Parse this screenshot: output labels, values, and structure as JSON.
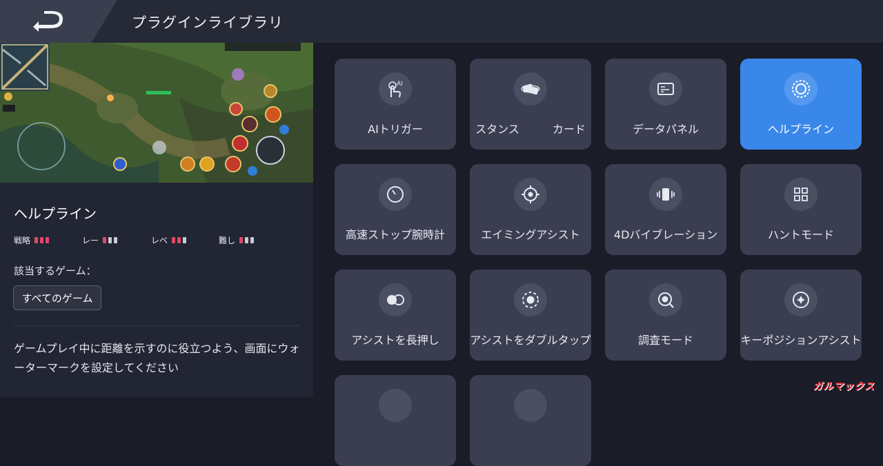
{
  "header": {
    "title": "プラグインライブラリ"
  },
  "detail": {
    "name": "ヘルプライン",
    "ratings": [
      {
        "label": "戦略",
        "level": 3,
        "max": 3
      },
      {
        "label": "レー",
        "level": 1,
        "max": 3
      },
      {
        "label": "レベ",
        "level": 2,
        "max": 3
      },
      {
        "label": "難し",
        "level": 1,
        "max": 3
      }
    ],
    "games_label": "該当するゲーム：",
    "games_button": "すべてのゲーム",
    "description": "ゲームプレイ中に距離を示すのに役立つよう、画面にウォーターマークを設定してください"
  },
  "plugins": [
    {
      "label": "AIトリガー",
      "icon": "ai-touch-icon",
      "active": false
    },
    {
      "label": "スタンス　　　カード",
      "icon": "cards-icon",
      "active": false
    },
    {
      "label": "データパネル",
      "icon": "data-panel-icon",
      "active": false
    },
    {
      "label": "ヘルプライン",
      "icon": "helpline-icon",
      "active": true
    },
    {
      "label": "高速ストップ腕時計",
      "icon": "stopwatch-icon",
      "active": false
    },
    {
      "label": "エイミングアシスト",
      "icon": "crosshair-icon",
      "active": false
    },
    {
      "label": "4Dバイブレーション",
      "icon": "vibration-icon",
      "active": false
    },
    {
      "label": "ハントモード",
      "icon": "hunt-icon",
      "active": false
    },
    {
      "label": "アシストを長押し",
      "icon": "long-press-icon",
      "active": false
    },
    {
      "label": "アシストをダブルタップ",
      "icon": "double-tap-icon",
      "active": false
    },
    {
      "label": "調査モード",
      "icon": "search-mode-icon",
      "active": false
    },
    {
      "label": "キーポジションアシスト",
      "icon": "key-position-icon",
      "active": false
    }
  ],
  "watermark": "ガルマックス",
  "colors": {
    "accent": "#3a87ea",
    "rating_on": "#e0486a"
  }
}
